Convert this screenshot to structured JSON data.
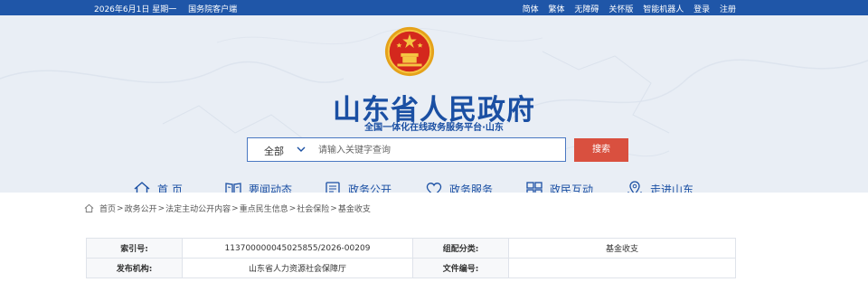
{
  "topbar": {
    "date": "2026年6月1日 星期一",
    "portal_link": "国务院客户端",
    "links": [
      "简体",
      "繁体",
      "无障碍",
      "关怀版",
      "智能机器人",
      "登录",
      "注册"
    ]
  },
  "header": {
    "title": "山东省人民政府",
    "subtitle": "全国一体化在线政务服务平台·山东"
  },
  "search": {
    "scope": "全部",
    "placeholder": "请输入关键字查询",
    "button": "搜索"
  },
  "nav": {
    "items": [
      {
        "label": "首 页",
        "icon": "home-icon"
      },
      {
        "label": "要闻动态",
        "icon": "news-icon"
      },
      {
        "label": "政务公开",
        "icon": "open-affairs-icon"
      },
      {
        "label": "政务服务",
        "icon": "heart-service-icon"
      },
      {
        "label": "政民互动",
        "icon": "interaction-icon"
      },
      {
        "label": "走进山东",
        "icon": "map-pin-icon"
      }
    ]
  },
  "breadcrumb": [
    "首页",
    "政务公开",
    "法定主动公开内容",
    "重点民生信息",
    "社会保险",
    "基金收支"
  ],
  "info_table": {
    "rows": [
      {
        "k1": "索引号:",
        "v1": "11370000004502585​5/2026-00209",
        "k2": "组配分类:",
        "v2": "基金收支"
      },
      {
        "k1": "发布机构:",
        "v1": "山东省人力资源社会保障厅",
        "k2": "文件编号:",
        "v2": ""
      }
    ]
  },
  "colors": {
    "brand_blue": "#1f56a8",
    "search_red": "#d9503f"
  }
}
